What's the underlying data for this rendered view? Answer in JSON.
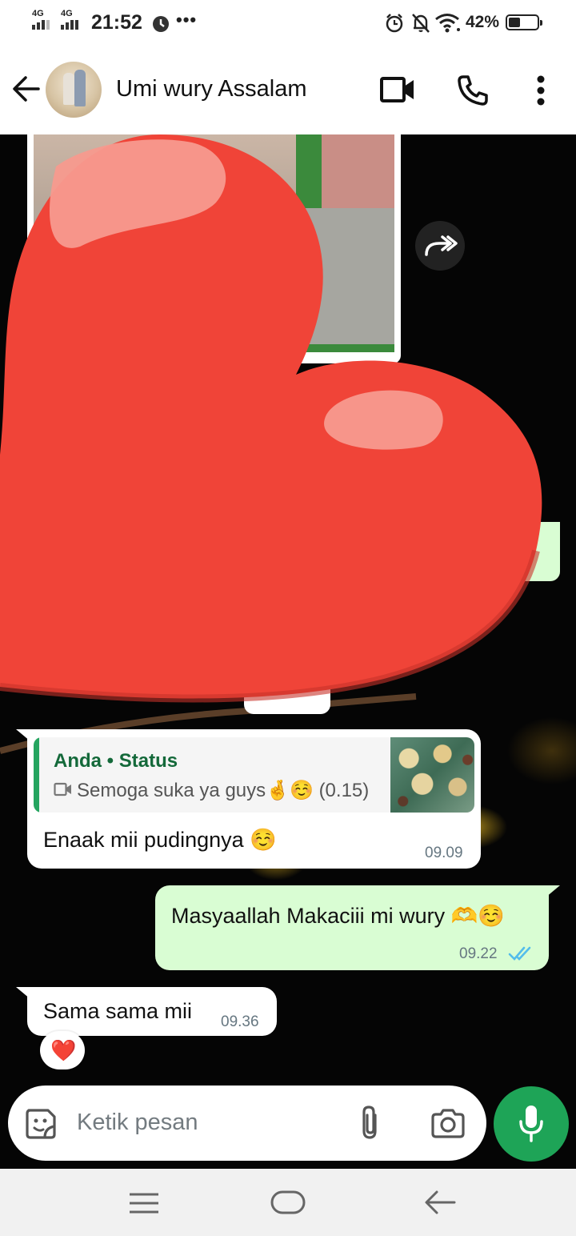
{
  "status_bar": {
    "network_1": "4G",
    "network_2": "4G",
    "time": "21:52",
    "dots": "•••",
    "battery_text": "42%",
    "battery_level": 0.42
  },
  "header": {
    "contact_name": "Umi wury Assalam"
  },
  "messages": [
    {
      "type": "incoming",
      "quote_title": "Anda • Status",
      "quote_text": "Semoga suka ya guys🤞☺️ (0.15)",
      "text": "Enaak mii pudingnya ☺️",
      "time": "09.09"
    },
    {
      "type": "outgoing",
      "text": "Masyaallah Makaciii mi wury 🫶☺️",
      "time": "09.22",
      "status": "read"
    },
    {
      "type": "incoming",
      "text": "Sama sama mii",
      "time": "09.36",
      "reaction": "❤️"
    }
  ],
  "input": {
    "placeholder": "Ketik pesan"
  },
  "colors": {
    "outgoing_bubble": "#d9fdd3",
    "incoming_bubble": "#ffffff",
    "accent_green": "#1ea457",
    "read_ticks": "#53bdeb",
    "heart": "#f04438"
  }
}
